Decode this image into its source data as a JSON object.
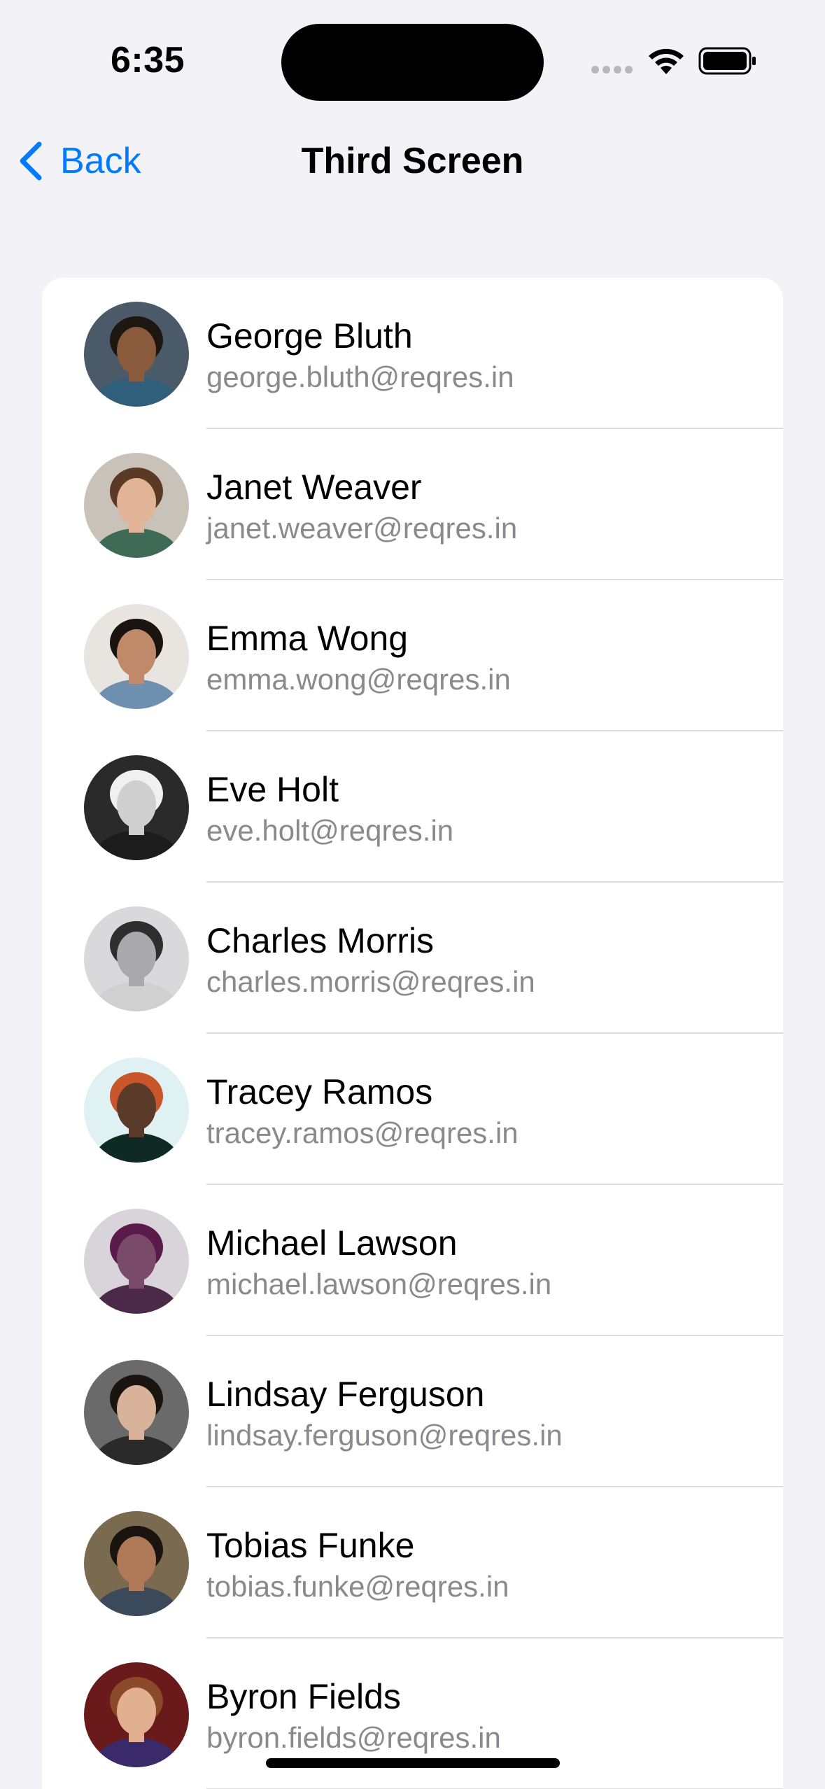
{
  "status_bar": {
    "time": "6:35"
  },
  "nav": {
    "back_label": "Back",
    "title": "Third Screen",
    "accent_color": "#007aff"
  },
  "users": [
    {
      "name": "George Bluth",
      "email": "george.bluth@reqres.in",
      "avatar_bg": "#4a5a68",
      "skin": "#8a5a3c",
      "hair": "#1e1610",
      "shirt": "#2f5f7a"
    },
    {
      "name": "Janet Weaver",
      "email": "janet.weaver@reqres.in",
      "avatar_bg": "#c9c2b8",
      "skin": "#e2b497",
      "hair": "#5a3a24",
      "shirt": "#3f6a55"
    },
    {
      "name": "Emma Wong",
      "email": "emma.wong@reqres.in",
      "avatar_bg": "#e8e4e0",
      "skin": "#c08a6a",
      "hair": "#1a1410",
      "shirt": "#6d8fb0"
    },
    {
      "name": "Eve Holt",
      "email": "eve.holt@reqres.in",
      "avatar_bg": "#2a2a2a",
      "skin": "#cfcfcf",
      "hair": "#f0f0f0",
      "shirt": "#1c1c1c"
    },
    {
      "name": "Charles Morris",
      "email": "charles.morris@reqres.in",
      "avatar_bg": "#d9d9dc",
      "skin": "#a9a9ac",
      "hair": "#2e2e2e",
      "shirt": "#d0d0d0"
    },
    {
      "name": "Tracey Ramos",
      "email": "tracey.ramos@reqres.in",
      "avatar_bg": "#dff1f3",
      "skin": "#5a3a28",
      "hair": "#c8562a",
      "shirt": "#0f2a24"
    },
    {
      "name": "Michael Lawson",
      "email": "michael.lawson@reqres.in",
      "avatar_bg": "#d8d4da",
      "skin": "#7a4a6a",
      "hair": "#5a1a4a",
      "shirt": "#4a2a48"
    },
    {
      "name": "Lindsay Ferguson",
      "email": "lindsay.ferguson@reqres.in",
      "avatar_bg": "#6a6a6a",
      "skin": "#d8b29a",
      "hair": "#1a1410",
      "shirt": "#2a2a2a"
    },
    {
      "name": "Tobias Funke",
      "email": "tobias.funke@reqres.in",
      "avatar_bg": "#7a6a50",
      "skin": "#b07a58",
      "hair": "#1a1410",
      "shirt": "#3a4a5a"
    },
    {
      "name": "Byron Fields",
      "email": "byron.fields@reqres.in",
      "avatar_bg": "#6a1a1a",
      "skin": "#e0b090",
      "hair": "#8a4a2a",
      "shirt": "#3a2a6a"
    }
  ]
}
